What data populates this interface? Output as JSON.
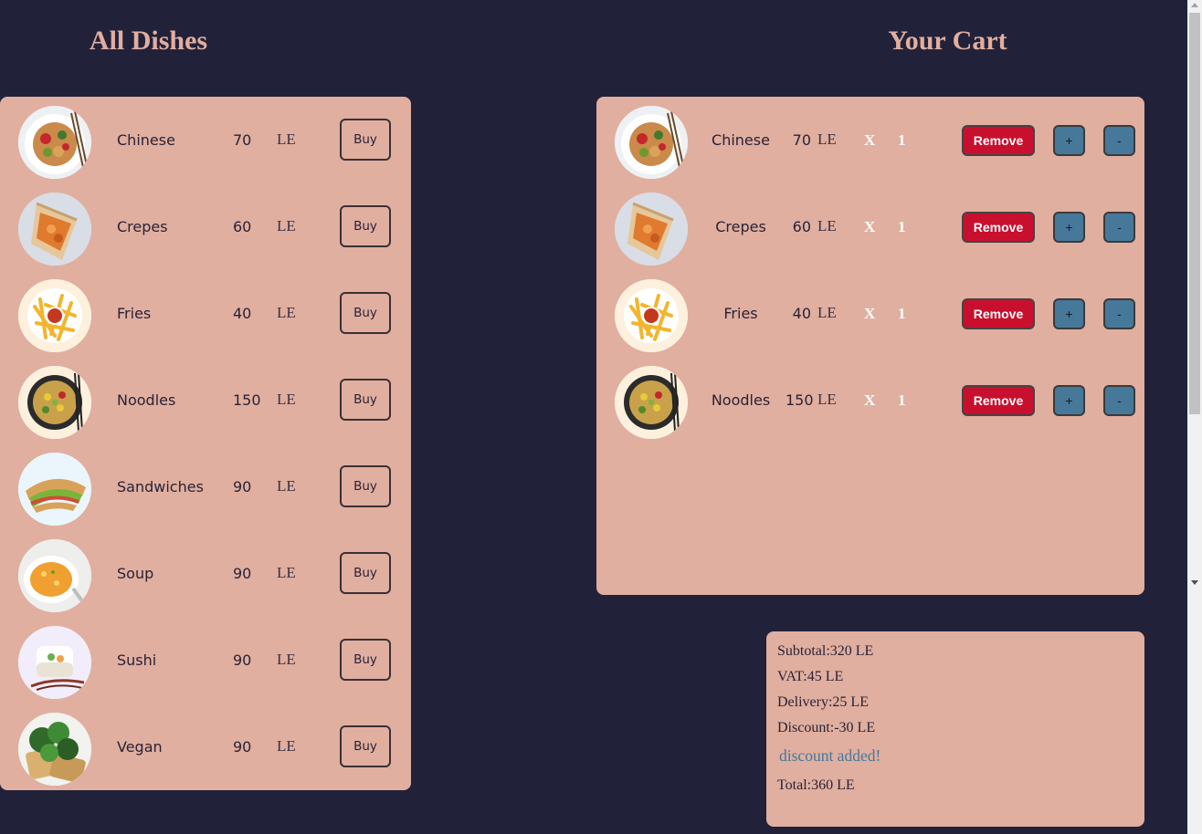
{
  "dishes_title": "All Dishes",
  "cart_title": "Your Cart",
  "dishes": [
    {
      "name": "Chinese",
      "price": "70",
      "unit": "LE",
      "buy": "Buy",
      "img": "chinese"
    },
    {
      "name": "Crepes",
      "price": "60",
      "unit": "LE",
      "buy": "Buy",
      "img": "crepes"
    },
    {
      "name": "Fries",
      "price": "40",
      "unit": "LE",
      "buy": "Buy",
      "img": "fries"
    },
    {
      "name": "Noodles",
      "price": "150",
      "unit": "LE",
      "buy": "Buy",
      "img": "noodles"
    },
    {
      "name": "Sandwiches",
      "price": "90",
      "unit": "LE",
      "buy": "Buy",
      "img": "sandwiches"
    },
    {
      "name": "Soup",
      "price": "90",
      "unit": "LE",
      "buy": "Buy",
      "img": "soup"
    },
    {
      "name": "Sushi",
      "price": "90",
      "unit": "LE",
      "buy": "Buy",
      "img": "sushi"
    },
    {
      "name": "Vegan",
      "price": "90",
      "unit": "LE",
      "buy": "Buy",
      "img": "vegan"
    }
  ],
  "cart": [
    {
      "name": "Chinese",
      "price": "70",
      "unit": "LE",
      "x": "X",
      "qty": "1",
      "remove": "Remove",
      "plus": "+",
      "minus": "-",
      "img": "chinese"
    },
    {
      "name": "Crepes",
      "price": "60",
      "unit": "LE",
      "x": "X",
      "qty": "1",
      "remove": "Remove",
      "plus": "+",
      "minus": "-",
      "img": "crepes"
    },
    {
      "name": "Fries",
      "price": "40",
      "unit": "LE",
      "x": "X",
      "qty": "1",
      "remove": "Remove",
      "plus": "+",
      "minus": "-",
      "img": "fries"
    },
    {
      "name": "Noodles",
      "price": "150",
      "unit": "LE",
      "x": "X",
      "qty": "1",
      "remove": "Remove",
      "plus": "+",
      "minus": "-",
      "img": "noodles"
    }
  ],
  "summary": {
    "subtotal": "Subtotal:320 LE",
    "vat": "VAT:45 LE",
    "delivery": "Delivery:25 LE",
    "discount": "Discount:-30 LE",
    "discount_note": "discount added!",
    "total": "Total:360 LE"
  },
  "colors": {
    "background": "#22213a",
    "panel": "#e0afa0",
    "heading": "#e1ae9f",
    "remove": "#c8102e",
    "qty_button": "#46789a"
  }
}
